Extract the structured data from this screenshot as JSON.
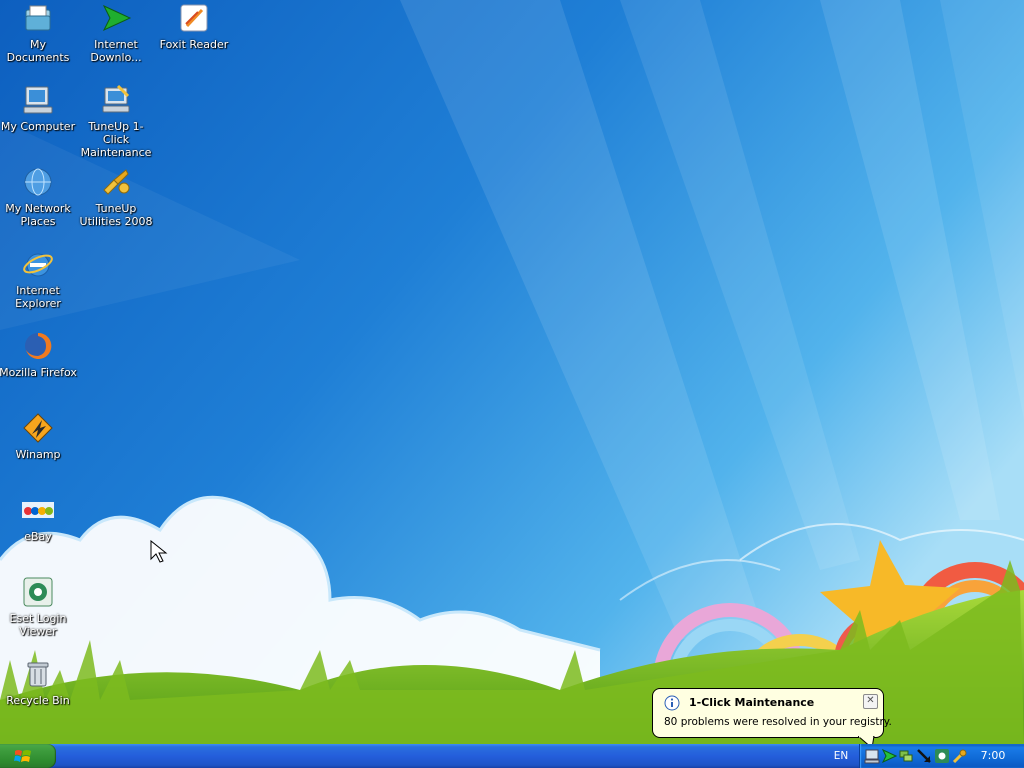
{
  "desktop": {
    "icons": [
      {
        "label": "My Documents",
        "icon": "my-documents-icon"
      },
      {
        "label": "Internet Downlo...",
        "icon": "internet-download-manager-icon"
      },
      {
        "label": "Foxit Reader",
        "icon": "foxit-reader-icon"
      },
      {
        "label": "My Computer",
        "icon": "my-computer-icon"
      },
      {
        "label": "TuneUp 1-Click Maintenance",
        "icon": "tuneup-1-click-icon"
      },
      {
        "label": "My Network Places",
        "icon": "network-places-icon"
      },
      {
        "label": "TuneUp Utilities 2008",
        "icon": "tuneup-utilities-icon"
      },
      {
        "label": "Internet Explorer",
        "icon": "internet-explorer-icon"
      },
      {
        "label": "Mozilla Firefox",
        "icon": "firefox-icon"
      },
      {
        "label": "Winamp",
        "icon": "winamp-icon"
      },
      {
        "label": "eBay",
        "icon": "ebay-icon"
      },
      {
        "label": "Eset Login Viewer",
        "icon": "eset-login-viewer-icon"
      },
      {
        "label": "Recycle Bin",
        "icon": "recycle-bin-icon"
      }
    ]
  },
  "balloon": {
    "title": "1-Click Maintenance",
    "message": "80 problems were resolved in your registry.",
    "close_label": "✕"
  },
  "taskbar": {
    "language": "EN",
    "clock": "7:00",
    "tray_icons": [
      "tuneup-tray-icon",
      "download-tray-icon",
      "network-tray-icon",
      "arrow-tray-icon",
      "eset-tray-icon",
      "tools-tray-icon"
    ]
  },
  "colors": {
    "taskbar": "#245edb",
    "start_button": "#3c9b3c",
    "balloon_bg": "#ffffe1",
    "sky": "#1b6fc7"
  }
}
